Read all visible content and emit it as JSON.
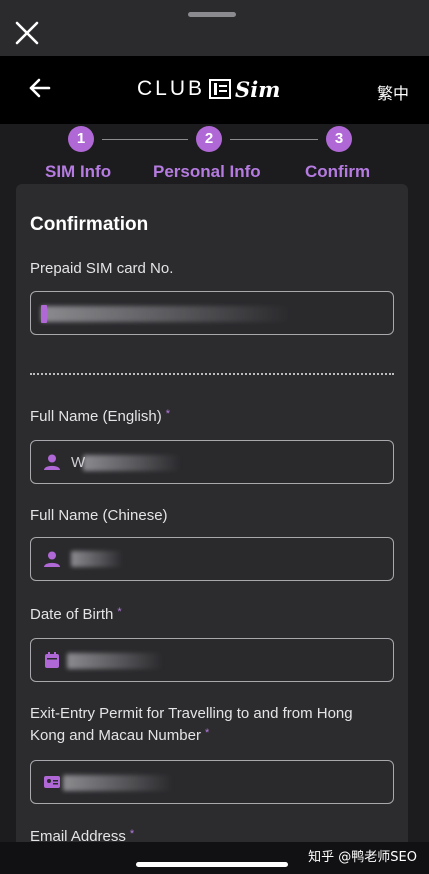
{
  "header": {
    "logo_text": "CLUB",
    "logo_script": "Sim",
    "language_toggle": "繁中"
  },
  "stepper": {
    "steps": [
      {
        "number": "1",
        "label": "SIM Info"
      },
      {
        "number": "2",
        "label": "Personal Info"
      },
      {
        "number": "3",
        "label": "Confirm"
      }
    ]
  },
  "form": {
    "title": "Confirmation",
    "sim_card": {
      "label": "Prepaid SIM card No.",
      "value": ""
    },
    "full_name_en": {
      "label": "Full Name (English)",
      "required": "*",
      "value": "W"
    },
    "full_name_cn": {
      "label": "Full Name (Chinese)",
      "value": ""
    },
    "dob": {
      "label": "Date of Birth",
      "required": "*",
      "value": ""
    },
    "permit": {
      "label_line1": "Exit-Entry Permit for Travelling to and from Hong",
      "label_line2": "Kong and Macau Number",
      "required": "*",
      "value": ""
    },
    "email": {
      "label": "Email Address",
      "required": "*"
    }
  },
  "watermark": "知乎 @鸭老师SEO",
  "colors": {
    "accent": "#b068d6",
    "card": "#2c2c2e",
    "background": "#1c1c1e"
  }
}
